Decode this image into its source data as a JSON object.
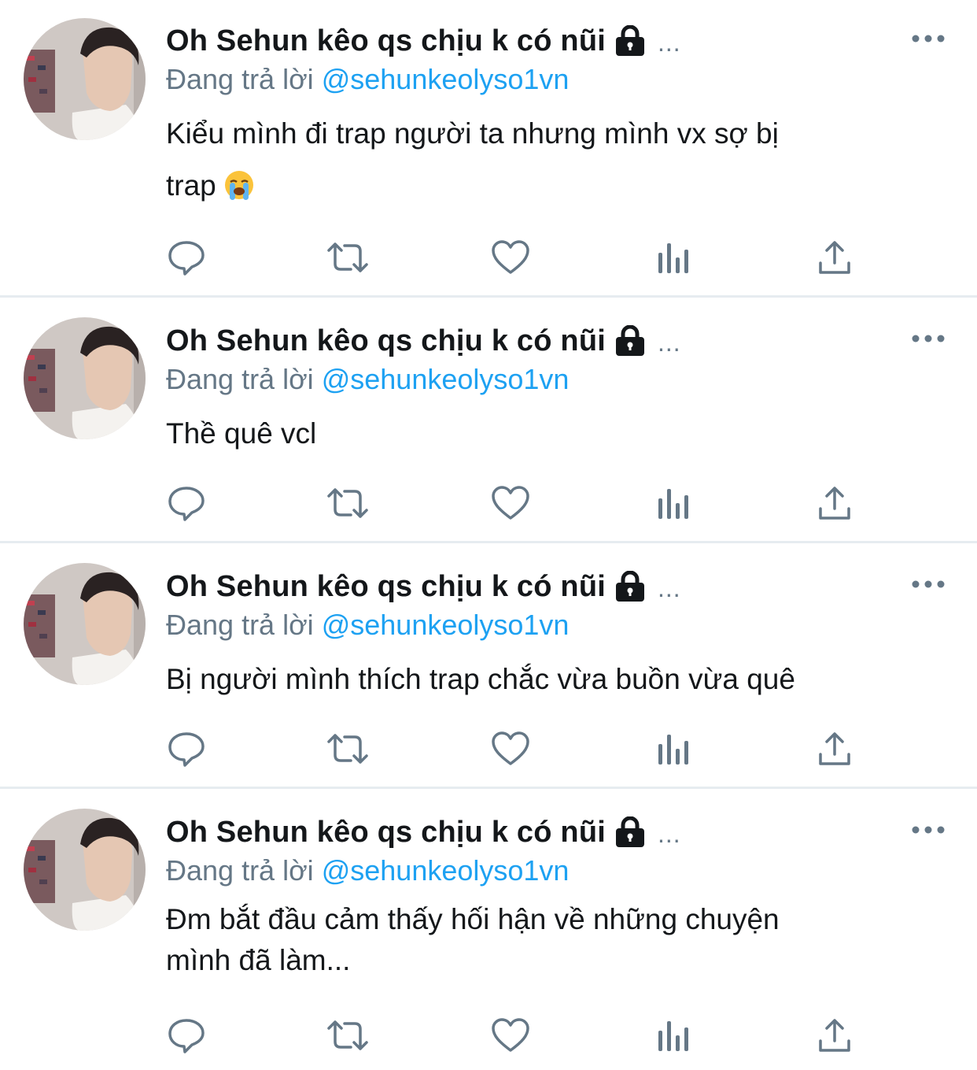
{
  "tweets": [
    {
      "author_name": "Oh Sehun kêo qs chịu k có nũi",
      "name_overflow": "...",
      "reply_prefix": "Đang trả lời",
      "reply_handle": "@sehunkeolyso1vn",
      "text_line1": "Kiểu mình đi trap người ta nhưng mình vx sợ bị",
      "text_line2": "trap",
      "emoji": "loudly-crying-face"
    },
    {
      "author_name": "Oh Sehun kêo qs chịu k có nũi",
      "name_overflow": "...",
      "reply_prefix": "Đang trả lời",
      "reply_handle": "@sehunkeolyso1vn",
      "text_line1": "Thề quê vcl"
    },
    {
      "author_name": "Oh Sehun kêo qs chịu k có nũi",
      "name_overflow": "...",
      "reply_prefix": "Đang trả lời",
      "reply_handle": "@sehunkeolyso1vn",
      "text_line1": "Bị người mình thích trap chắc vừa buồn vừa quê"
    },
    {
      "author_name": "Oh Sehun kêo qs chịu k có nũi",
      "name_overflow": "...",
      "reply_prefix": "Đang trả lời",
      "reply_handle": "@sehunkeolyso1vn",
      "text_line1": "Đm bắt đầu cảm thấy hối hận về những chuyện",
      "text_line2": "mình đã làm..."
    }
  ],
  "icons": {
    "lock": "lock-icon",
    "more": "more-options-icon",
    "reply": "reply-icon",
    "retweet": "retweet-icon",
    "like": "heart-icon",
    "analytics": "analytics-icon",
    "share": "share-icon"
  },
  "colors": {
    "text": "#14171a",
    "secondary": "#657786",
    "link": "#1da1f2",
    "divider": "#e6ecf0",
    "icon": "#657786"
  }
}
